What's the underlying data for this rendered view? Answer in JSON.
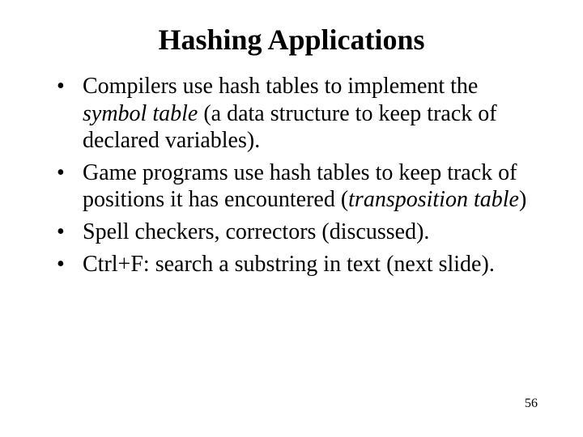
{
  "title": "Hashing Applications",
  "bullets": {
    "b1": {
      "t1": "Compilers use hash tables to implement the ",
      "i1": "symbol table",
      "t2": " (a data structure to keep track of declared variables)."
    },
    "b2": {
      "t1": "Game programs use hash tables to keep track of positions it has encountered (",
      "i1": "transposition table",
      "t2": ")"
    },
    "b3": {
      "t1": "Spell checkers, correctors (discussed)."
    },
    "b4": {
      "t1": "Ctrl+F: search a substring in text (next slide)."
    }
  },
  "page_number": "56"
}
